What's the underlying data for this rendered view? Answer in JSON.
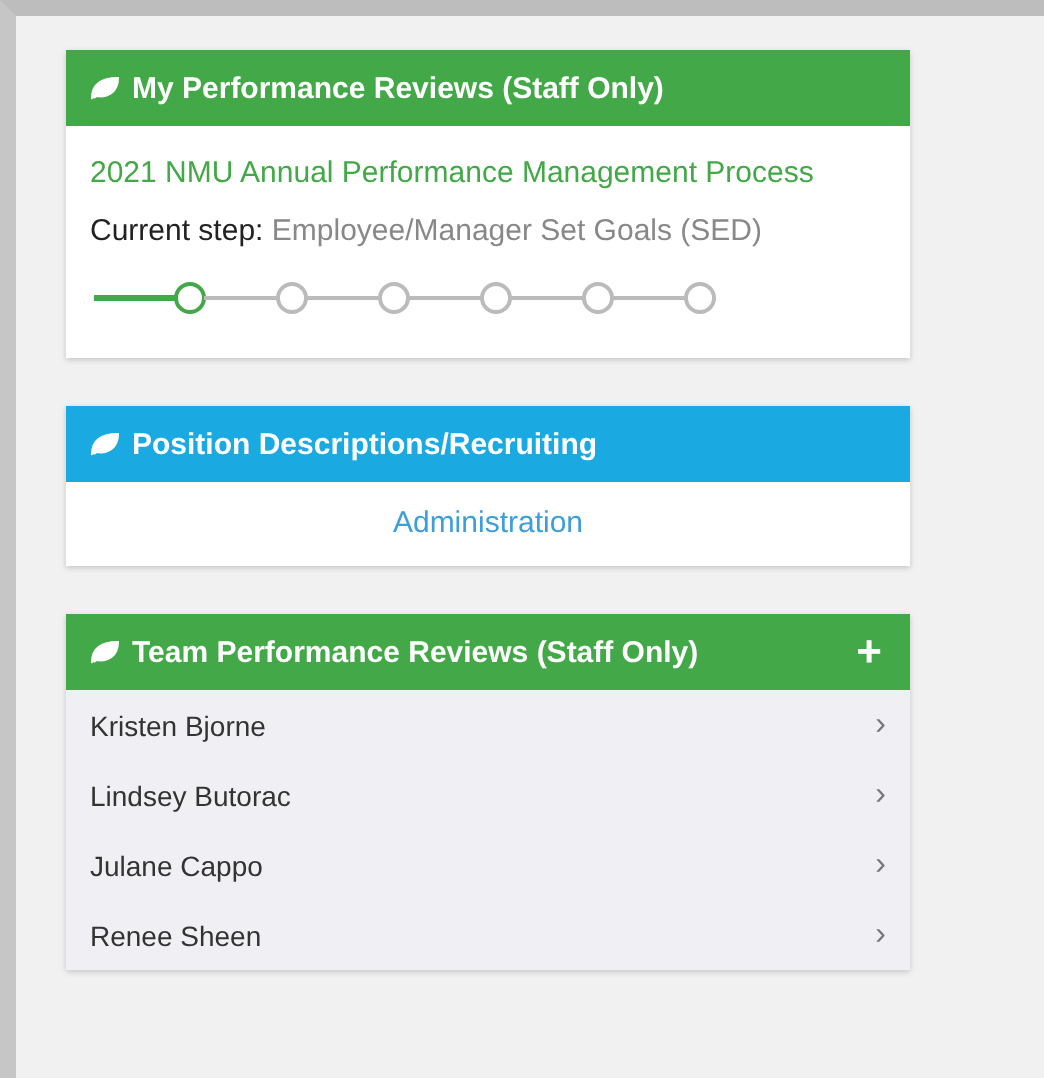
{
  "cards": [
    {
      "kind": "process",
      "title": "My Performance Reviews (Staff Only)",
      "color": "#43a847",
      "process_title": "2021 NMU Annual Performance Management Process",
      "step_label": "Current step:",
      "step_value": "Employee/Manager Set Goals (SED)",
      "steps": [
        {
          "selected": true
        },
        {
          "selected": false
        },
        {
          "selected": false
        },
        {
          "selected": false
        },
        {
          "selected": false
        },
        {
          "selected": false
        }
      ]
    },
    {
      "kind": "links",
      "title": "Position Descriptions/Recruiting",
      "color": "#1ba9e1",
      "links": [
        "Administration"
      ]
    },
    {
      "kind": "people",
      "title": "Team Performance Reviews (Staff Only)",
      "color": "#43a847",
      "action": "+",
      "rows": [
        {
          "name": "Kristen Bjorne",
          "chevron": "›"
        },
        {
          "name": "Lindsey Butorac",
          "chevron": "›"
        },
        {
          "name": "Julane Cappo",
          "chevron": "›"
        },
        {
          "name": "Renee Sheen",
          "chevron": "›"
        }
      ]
    }
  ]
}
